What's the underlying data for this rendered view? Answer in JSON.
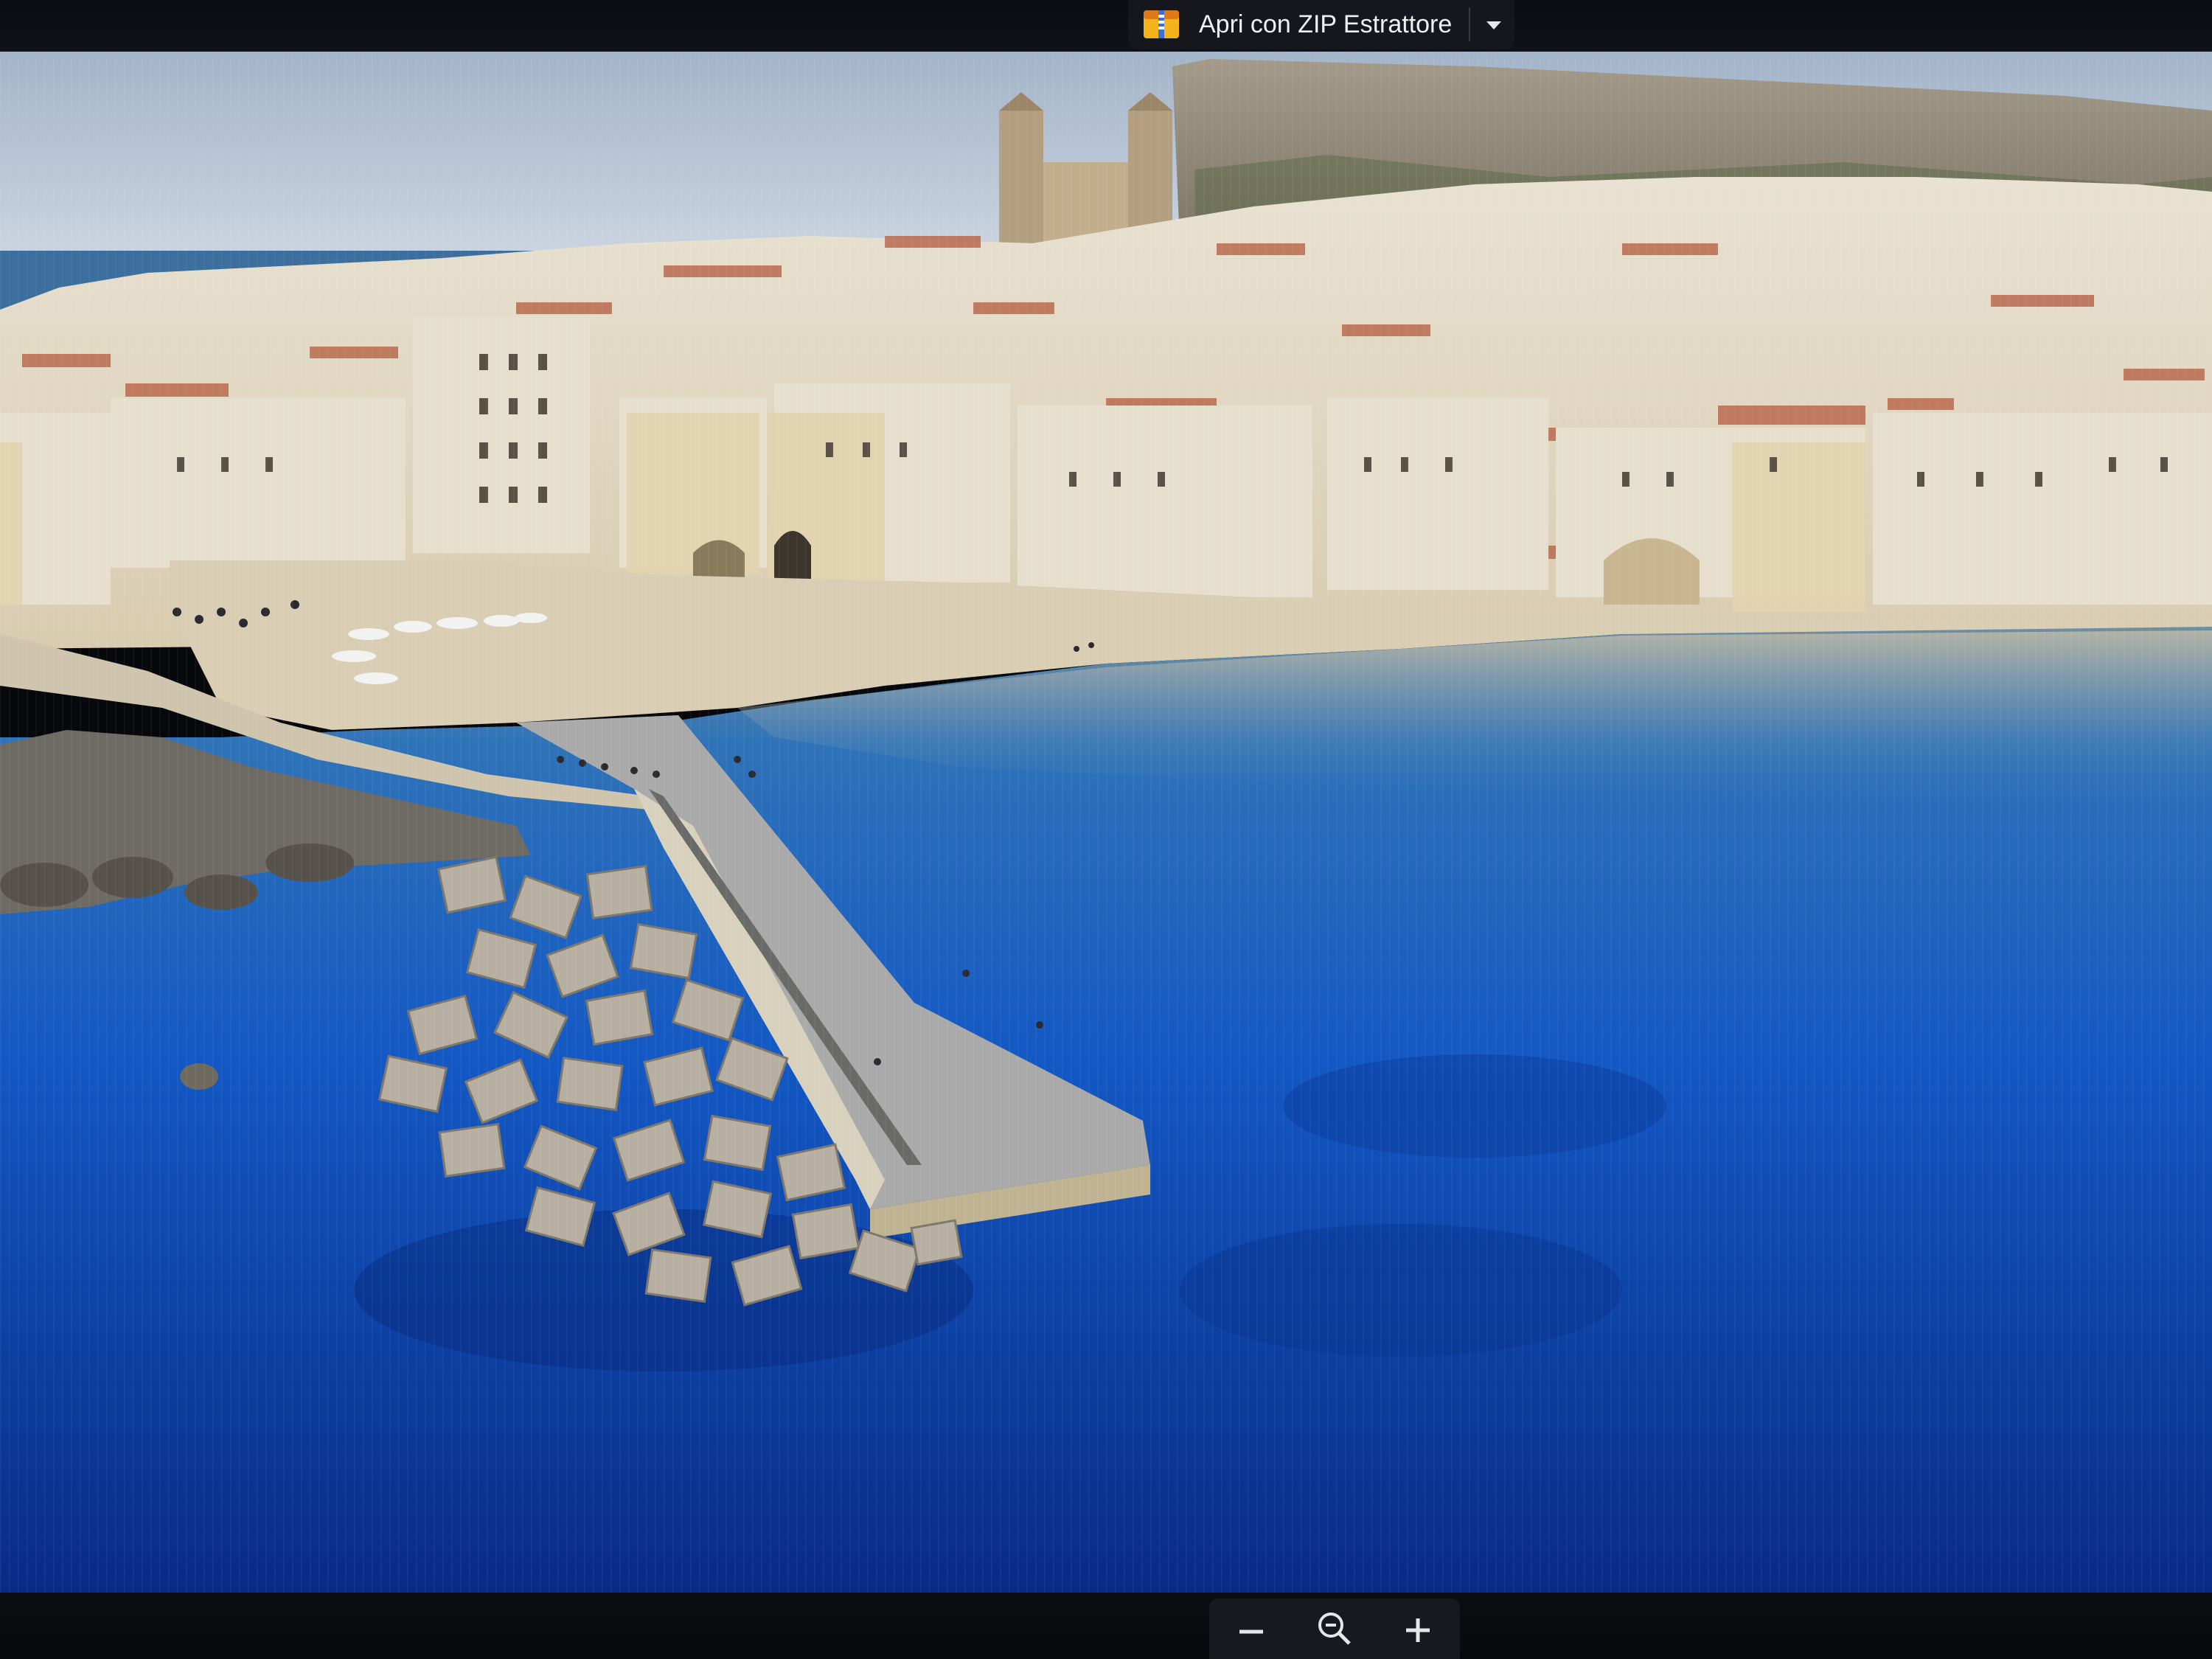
{
  "toolbar": {
    "open_with_label": "Apri con ZIP Estrattore",
    "app_icon": "zip-archive-icon",
    "menu_icon": "chevron-down-icon"
  },
  "viewer": {
    "image_description_icon": "photo-image",
    "zoom_controls": {
      "zoom_out_icon": "minus-icon",
      "zoom_reset_icon": "zoom-magnifier-icon",
      "zoom_in_icon": "plus-icon"
    }
  },
  "colors": {
    "sea_deep": "#0a2f8f",
    "sea_mid": "#1560c8",
    "toolbar_bg": "#16171d",
    "text": "#f0f0f2"
  }
}
